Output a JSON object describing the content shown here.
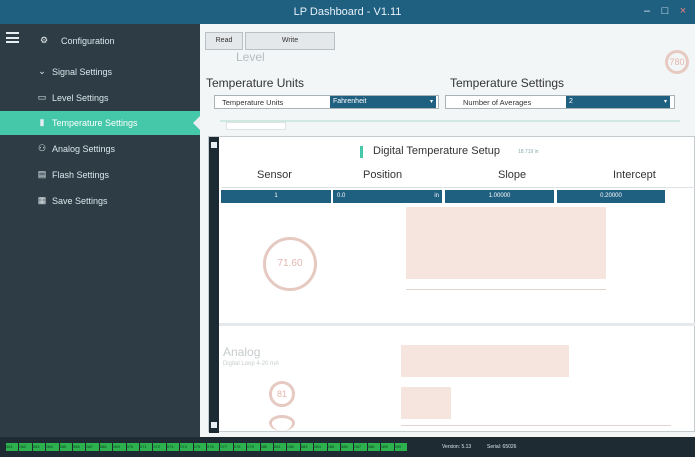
{
  "window": {
    "title": "LP Dashboard - V1.11",
    "controls": {
      "minimize": "–",
      "maximize": "□",
      "close": "×"
    }
  },
  "sidebar": {
    "items": [
      {
        "label": "Configuration",
        "icon": "gear-icon",
        "glyph": "⚙"
      },
      {
        "label": "Signal Settings",
        "icon": "chevron-down-icon",
        "glyph": "⌄"
      },
      {
        "label": "Level Settings",
        "icon": "level-icon",
        "glyph": "▭"
      },
      {
        "label": "Temperature Settings",
        "icon": "thermometer-icon",
        "glyph": "🌡"
      },
      {
        "label": "Analog Settings",
        "icon": "user-icon",
        "glyph": "⚇"
      },
      {
        "label": "Flash Settings",
        "icon": "flash-icon",
        "glyph": "▤"
      },
      {
        "label": "Save Settings",
        "icon": "save-icon",
        "glyph": "▦"
      }
    ]
  },
  "toolbar": {
    "read_label": "Read",
    "write_label": "Write"
  },
  "background": {
    "level_label": "Level",
    "gauge_value": "780"
  },
  "temperature_units": {
    "section_title": "Temperature Units",
    "field_label": "Temperature Units",
    "value": "Fahrenheit"
  },
  "temperature_settings": {
    "section_title": "Temperature Settings",
    "field_label": "Number of Averages",
    "value": "2"
  },
  "digital_setup": {
    "title": "Digital Temperature Setup",
    "note": "18.719 in",
    "columns": [
      "Sensor",
      "Position",
      "Slope",
      "Intercept"
    ],
    "row": {
      "sensor": "1",
      "position": "0.0",
      "position_unit": "in",
      "slope": "1.00000",
      "intercept": "0.20000"
    }
  },
  "faded_overlay": {
    "temp_value": "71.60",
    "analog_title": "Analog",
    "analog_subtitle": "Digital Loop 4-20 mA",
    "analog_value": "81"
  },
  "statusbar": {
    "version": "Version: 5.13",
    "serial": "Serial: 65026",
    "segments": [
      "061",
      "062",
      "063",
      "064",
      "065",
      "066",
      "067",
      "068",
      "069",
      "070",
      "071",
      "072",
      "073",
      "074",
      "075",
      "076",
      "077",
      "078",
      "079",
      "080",
      "081",
      "082",
      "083",
      "084",
      "085",
      "086",
      "087",
      "088",
      "089",
      "090"
    ]
  },
  "colors": {
    "accent": "#45c7a9",
    "titlebar": "#1f5f80",
    "sidebar": "#2e3d45",
    "status_green": "#2db14f"
  }
}
